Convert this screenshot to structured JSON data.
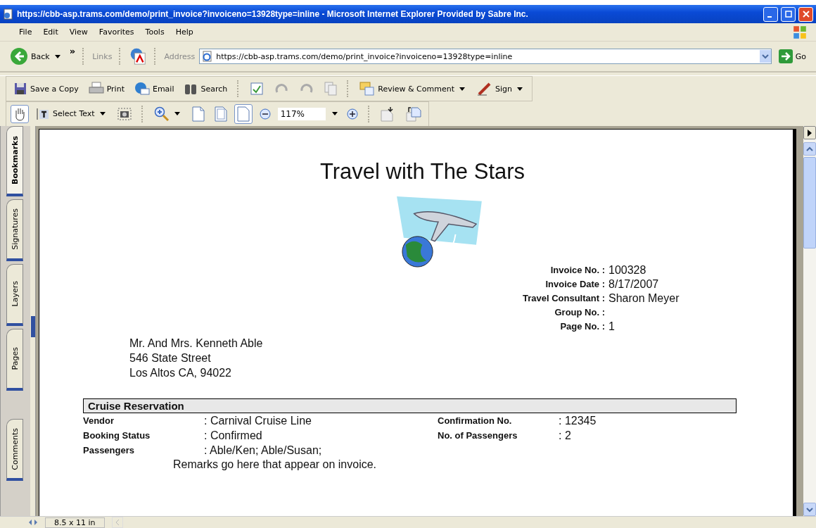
{
  "window": {
    "title": "https://cbb-asp.trams.com/demo/print_invoice?invoiceno=13928type=inline - Microsoft Internet Explorer Provided by Sabre Inc."
  },
  "menu": [
    "File",
    "Edit",
    "View",
    "Favorites",
    "Tools",
    "Help"
  ],
  "nav": {
    "back": "Back",
    "chevron": "»",
    "links": "Links",
    "address_label": "Address",
    "address": "https://cbb-asp.trams.com/demo/print_invoice?invoiceno=13928type=inline",
    "go": "Go"
  },
  "pdf_toolbar": [
    {
      "kind": "save",
      "label": "Save a Copy"
    },
    {
      "kind": "print",
      "label": "Print"
    },
    {
      "kind": "email",
      "label": "Email"
    },
    {
      "kind": "search",
      "label": "Search"
    },
    {
      "kind": "sep"
    },
    {
      "kind": "spell"
    },
    {
      "kind": "undo"
    },
    {
      "kind": "redo"
    },
    {
      "kind": "copy"
    },
    {
      "kind": "sep"
    },
    {
      "kind": "comment",
      "label": "Review & Comment",
      "menu": true
    },
    {
      "kind": "sign",
      "label": "Sign",
      "menu": true
    }
  ],
  "view_toolbar": {
    "hand_selected": true,
    "select_text": "Select Text",
    "zoom": "117%",
    "page_views": [
      {
        "kind": "actual",
        "selected": false
      },
      {
        "kind": "fit_page",
        "selected": false
      },
      {
        "kind": "fit_width",
        "selected": true
      }
    ]
  },
  "side_tabs": [
    {
      "label": "Bookmarks",
      "selected": true
    },
    {
      "label": "Signatures",
      "selected": false
    },
    {
      "label": "Layers",
      "selected": false
    },
    {
      "label": "Pages",
      "selected": false
    },
    {
      "label": "Comments",
      "selected": false
    }
  ],
  "document": {
    "company": "Travel with The Stars",
    "invoice_fields": [
      {
        "label": "Invoice No. :",
        "value": "100328"
      },
      {
        "label": "Invoice Date :",
        "value": "8/17/2007"
      },
      {
        "label": "Travel Consultant :",
        "value": "Sharon Meyer"
      },
      {
        "label": "Group No. :"
      },
      {
        "label": "Page No. :",
        "value": "1"
      }
    ],
    "address": [
      "Mr. And Mrs. Kenneth Able",
      "546 State Street",
      "Los Altos CA,  94022"
    ],
    "section": {
      "title": "Cruise Reservation",
      "left": [
        {
          "label": "Vendor",
          "value": ": Carnival Cruise Line"
        },
        {
          "label": "Booking Status",
          "value": ": Confirmed"
        },
        {
          "label": "Passengers",
          "value": ": Able/Ken; Able/Susan;"
        }
      ],
      "right": [
        {
          "label": "Confirmation No.",
          "value": ": 12345"
        },
        {
          "label": "No. of Passengers",
          "value": ": 2"
        }
      ],
      "remarks": "Remarks go here that appear on invoice."
    }
  },
  "status_bar": {
    "page_size": "8.5 x 11 in"
  }
}
